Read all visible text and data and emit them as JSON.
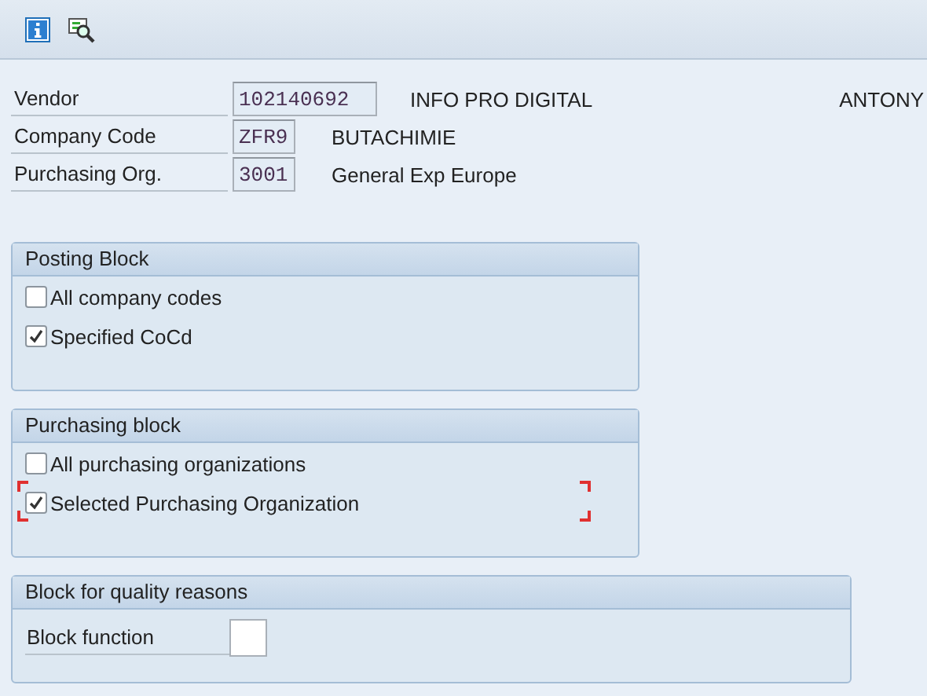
{
  "toolbar": {
    "buttons": [
      {
        "kind": "info"
      },
      {
        "kind": "find"
      }
    ]
  },
  "header_fields": [
    {
      "label": "Vendor",
      "value": "102140692",
      "description": "INFO PRO DIGITAL",
      "extra": "ANTONY"
    },
    {
      "label": "Company Code",
      "value": "ZFR9",
      "description": "BUTACHIMIE"
    },
    {
      "label": "Purchasing Org.",
      "value": "3001",
      "description": "General Exp Europe"
    }
  ],
  "groups": [
    {
      "title": "Posting Block",
      "items": [
        {
          "kind": "checkbox",
          "label": "All company codes",
          "checked": false,
          "focused": false
        },
        {
          "kind": "checkbox",
          "label": "Specified CoCd",
          "checked": true,
          "focused": false
        }
      ]
    },
    {
      "title": "Purchasing block",
      "items": [
        {
          "kind": "checkbox",
          "label": "All purchasing organizations",
          "checked": false,
          "focused": false
        },
        {
          "kind": "checkbox",
          "label": "Selected Purchasing Organization",
          "checked": true,
          "focused": true
        }
      ]
    },
    {
      "title": "Block for quality reasons",
      "items": [
        {
          "kind": "field",
          "label": "Block function"
        }
      ]
    }
  ]
}
